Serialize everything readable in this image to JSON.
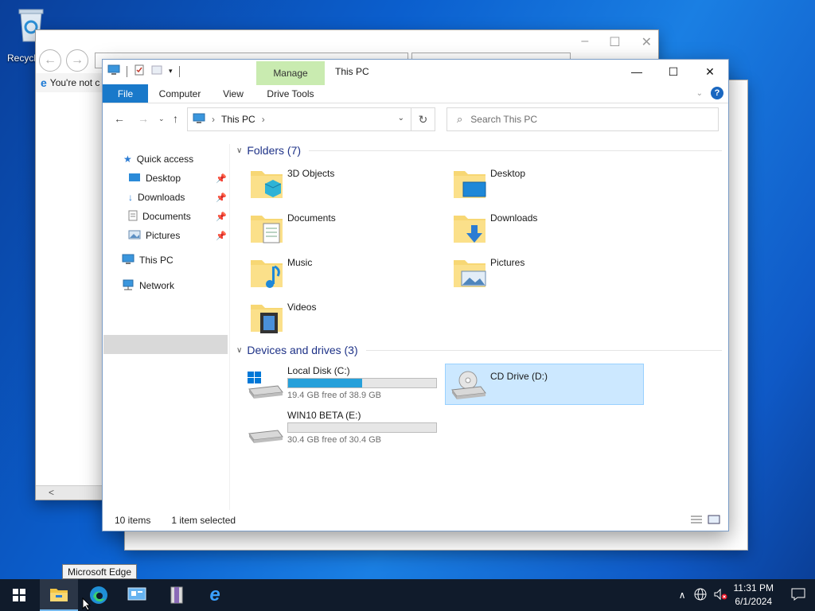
{
  "desktop": {
    "recycle_label": "Recycl"
  },
  "ie_window": {
    "tab_text": "You're not c"
  },
  "explorer": {
    "title": "This PC",
    "manage_tab": "Manage",
    "ribbon_tabs": {
      "file": "File",
      "computer": "Computer",
      "view": "View",
      "drive_tools": "Drive Tools"
    },
    "address": {
      "path": "This PC",
      "search_placeholder": "Search This PC"
    },
    "nav_pane": {
      "quick_access": "Quick access",
      "desktop": "Desktop",
      "downloads": "Downloads",
      "documents": "Documents",
      "pictures": "Pictures",
      "this_pc": "This PC",
      "network": "Network"
    },
    "sections": {
      "folders": "Folders (7)",
      "devices": "Devices and drives (3)"
    },
    "folders": [
      {
        "name": "3D Objects",
        "icon": "3d-objects-icon"
      },
      {
        "name": "Desktop",
        "icon": "desktop-folder-icon"
      },
      {
        "name": "Documents",
        "icon": "documents-folder-icon"
      },
      {
        "name": "Downloads",
        "icon": "downloads-folder-icon"
      },
      {
        "name": "Music",
        "icon": "music-folder-icon"
      },
      {
        "name": "Pictures",
        "icon": "pictures-folder-icon"
      },
      {
        "name": "Videos",
        "icon": "videos-folder-icon"
      }
    ],
    "drives": [
      {
        "name": "Local Disk (C:)",
        "free": "19.4 GB free of 38.9 GB",
        "used_fraction": 0.5
      },
      {
        "name": "CD Drive (D:)",
        "free": "",
        "selected": true
      },
      {
        "name": "WIN10 BETA (E:)",
        "free": "30.4 GB free of 30.4 GB",
        "used_fraction": 0.0
      }
    ],
    "status": {
      "items": "10 items",
      "selected": "1 item selected"
    }
  },
  "tooltip": "Microsoft Edge",
  "taskbar": {
    "time": "11:31 PM",
    "date": "6/1/2024"
  },
  "colors": {
    "accent": "#1979ca",
    "manage_tab": "#c9ebb0",
    "selection": "#cce8ff",
    "drive_fill": "#26a0da",
    "taskbar": "#101b2b"
  }
}
